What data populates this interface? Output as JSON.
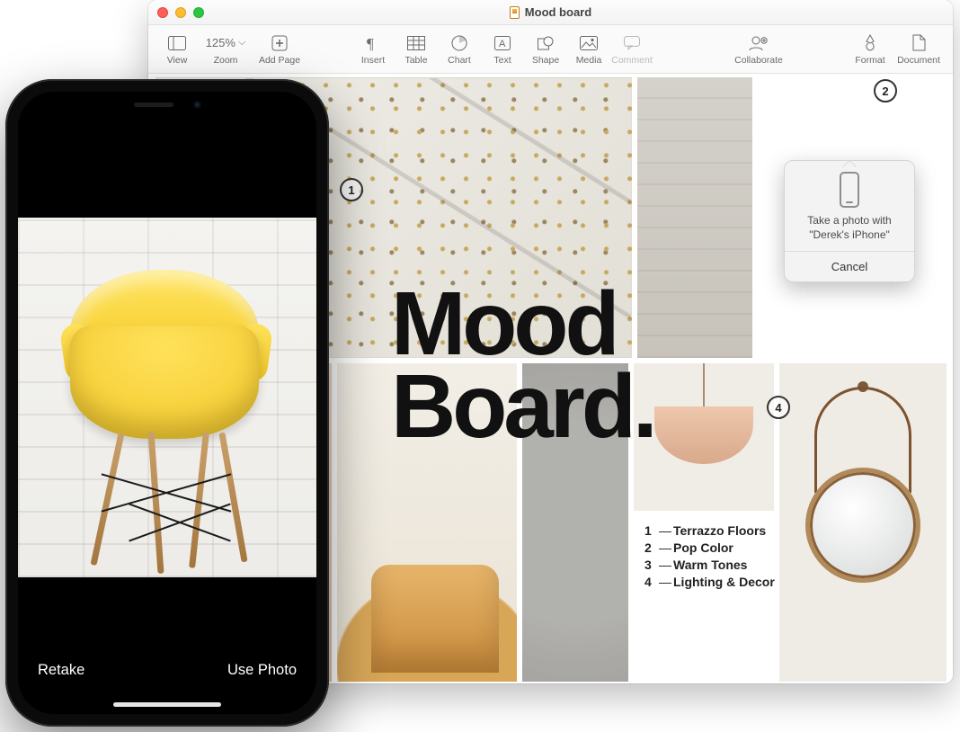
{
  "window": {
    "title": "Mood board",
    "traffic": {
      "close": "close",
      "minimize": "minimize",
      "zoom": "zoom"
    }
  },
  "toolbar": {
    "view": "View",
    "zoom_value": "125%",
    "zoom_label": "Zoom",
    "add_page": "Add Page",
    "insert": "Insert",
    "table": "Table",
    "chart": "Chart",
    "text": "Text",
    "shape": "Shape",
    "media": "Media",
    "comment": "Comment",
    "collaborate": "Collaborate",
    "format": "Format",
    "document": "Document"
  },
  "document": {
    "heading_line1": "Mood",
    "heading_line2": "Board.",
    "legend": [
      {
        "n": "1",
        "label": "Terrazzo Floors"
      },
      {
        "n": "2",
        "label": "Pop Color"
      },
      {
        "n": "3",
        "label": "Warm Tones"
      },
      {
        "n": "4",
        "label": "Lighting & Decor"
      }
    ],
    "callouts": {
      "c1": "1",
      "c2": "2",
      "c4": "4"
    }
  },
  "popover": {
    "message": "Take a photo with \"Derek's iPhone\"",
    "cancel": "Cancel"
  },
  "iphone": {
    "retake": "Retake",
    "use_photo": "Use Photo"
  }
}
